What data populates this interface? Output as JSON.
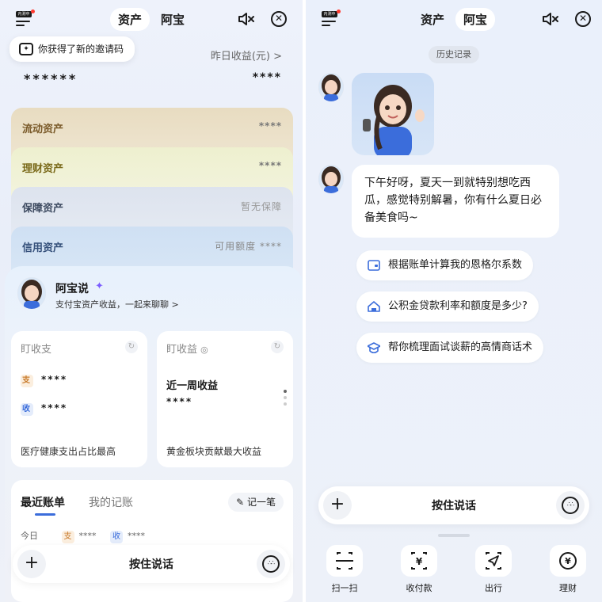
{
  "left": {
    "tabs": [
      "资产",
      "阿宝"
    ],
    "menu_badge": "内测中",
    "invite_tip": "你获得了新的邀请码",
    "yesterday_label": "昨日收益(元) >",
    "masked_total": "******",
    "masked_yesterday": "****",
    "cards": [
      {
        "label": "流动资产",
        "value": "****"
      },
      {
        "label": "理财资产",
        "value": "****"
      },
      {
        "label": "保障资产",
        "value": "暂无保障"
      },
      {
        "label": "信用资产",
        "value": "可用额度 ****"
      }
    ],
    "assistant": {
      "name": "阿宝说",
      "subtitle": "支付宝资产收益，一起来聊聊 >"
    },
    "income_expense": {
      "title": "盯收支",
      "expense_badge": "支",
      "expense_value": "****",
      "income_badge": "收",
      "income_value": "****",
      "footer": "医疗健康支出占比最高"
    },
    "earnings": {
      "title": "盯收益",
      "heading": "近一周收益",
      "value": "****",
      "footer": "黄金板块贡献最大收益"
    },
    "bills": {
      "tab_recent": "最近账单",
      "tab_mine": "我的记账",
      "record_button": "记一笔",
      "today_label": "今日",
      "today_expense": "****",
      "today_income": "****"
    },
    "voice": {
      "label": "按住说话"
    }
  },
  "right": {
    "tabs": [
      "资产",
      "阿宝"
    ],
    "menu_badge": "内测中",
    "history_label": "历史记录",
    "message": "下午好呀，夏天一到就特别想吃西瓜，感觉特别解暑，你有什么夏日必备美食吗~",
    "suggestions": [
      {
        "icon": "wallet-icon",
        "text": "根据账单计算我的恩格尔系数"
      },
      {
        "icon": "house-icon",
        "text": "公积金贷款利率和额度是多少?"
      },
      {
        "icon": "graduation-cap-icon",
        "text": "帮你梳理面试谈薪的高情商话术"
      }
    ],
    "voice": {
      "label": "按住说话"
    },
    "services": [
      {
        "icon": "scan-icon",
        "label": "扫一扫"
      },
      {
        "icon": "receive-payment-icon",
        "label": "收付款"
      },
      {
        "icon": "navigation-icon",
        "label": "出行"
      },
      {
        "icon": "finance-icon",
        "label": "理财"
      }
    ]
  }
}
